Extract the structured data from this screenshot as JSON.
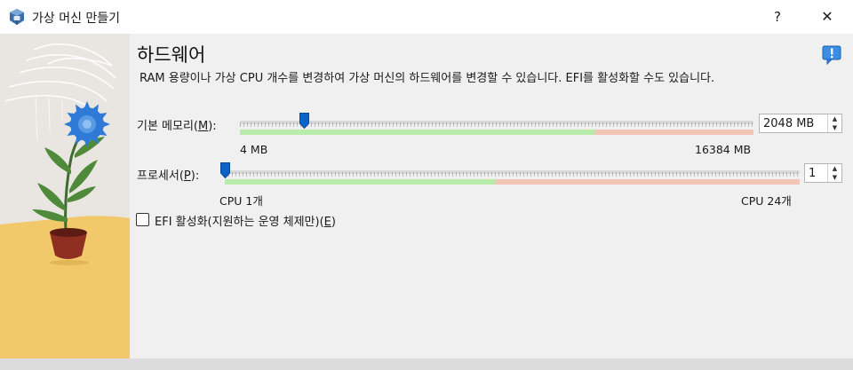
{
  "window": {
    "title": "가상 머신 만들기",
    "help_label": "?",
    "close_label": "✕"
  },
  "page": {
    "title": "하드웨어",
    "description": "RAM 용량이나 가상 CPU 개수를 변경하여 가상 머신의 하드웨어를 변경할 수 있습니다. EFI를 활성화할 수도 있습니다."
  },
  "memory": {
    "label_prefix": "기본 메모리(",
    "label_mnemonic": "M",
    "label_suffix": "):",
    "min_label": "4 MB",
    "max_label": "16384 MB",
    "value": "2048 MB",
    "slider_fraction": 0.125,
    "green_fraction": 0.69
  },
  "processor": {
    "label_prefix": "프로세서(",
    "label_mnemonic": "P",
    "label_suffix": "):",
    "min_label": "CPU 1개",
    "max_label": "CPU 24개",
    "value": "1",
    "slider_fraction": 0.0,
    "green_fraction": 0.47
  },
  "efi": {
    "label_prefix": "EFI 활성화(지원하는 운영 체제만)(",
    "label_mnemonic": "E",
    "label_suffix": ")",
    "checked": false
  },
  "colors": {
    "accent": "#0b63c9",
    "safe_zone": "#b7ecaa",
    "warn_zone": "#f3c5b6",
    "illustration_bg": "#e9e6e2",
    "illustration_floor": "#f2c96a"
  },
  "icons": {
    "app": "virtualbox-icon",
    "info": "info-balloon-icon",
    "close": "close-icon"
  }
}
